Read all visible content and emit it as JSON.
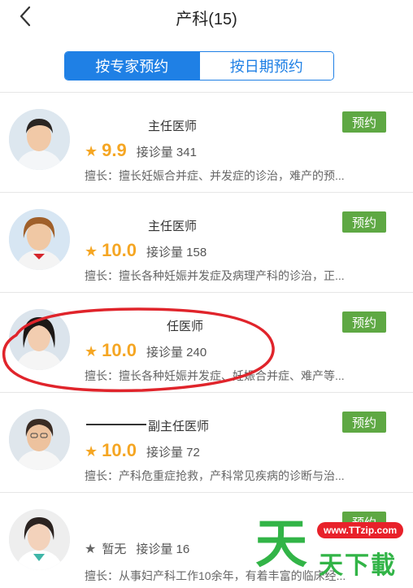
{
  "header": {
    "title": "产科(15)",
    "back_icon": "chevron-left-icon"
  },
  "tabs": [
    {
      "label": "按专家预约",
      "active": true
    },
    {
      "label": "按日期预约",
      "active": false
    }
  ],
  "doctors": [
    {
      "title": "主任医师",
      "rating": "9.9",
      "visits_label": "接诊量 341",
      "specialty": "擅长：擅长妊娠合并症、并发症的诊治，难产的预...",
      "book_label": "预约"
    },
    {
      "title": "主任医师",
      "rating": "10.0",
      "visits_label": "接诊量 158",
      "specialty": "擅长：擅长各种妊娠并发症及病理产科的诊治，正...",
      "book_label": "预约"
    },
    {
      "title": "任医师",
      "rating": "10.0",
      "visits_label": "接诊量 240",
      "specialty": "擅长：擅长各种妊娠并发症、妊娠合并症、难产等...",
      "book_label": "预约"
    },
    {
      "title": "副主任医师",
      "rating": "10.0",
      "visits_label": "接诊量 72",
      "specialty": "擅长：产科危重症抢救，产科常见疾病的诊断与治...",
      "book_label": "预约"
    },
    {
      "title": "",
      "rating": "暂无",
      "visits_label": "接诊量 16",
      "specialty": "擅长：从事妇产科工作10余年，有着丰富的临床经...",
      "book_label": "预约"
    }
  ],
  "watermark": {
    "url_text": "www.TTzip.com",
    "logo_char": "天",
    "brand_text": "天下載"
  },
  "colors": {
    "accent_blue": "#1f80e5",
    "book_green": "#5ea843",
    "star_orange": "#f5a623",
    "highlight_red": "#e0242b"
  }
}
